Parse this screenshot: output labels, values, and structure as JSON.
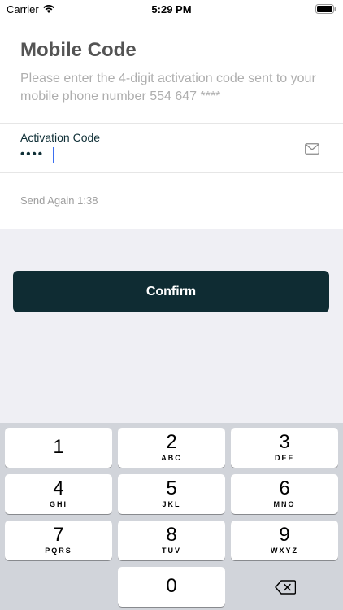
{
  "status_bar": {
    "carrier": "Carrier",
    "time": "5:29 PM"
  },
  "header": {
    "title": "Mobile Code",
    "subtitle": "Please enter the 4-digit activation code sent to your mobile phone number 554 647 ****"
  },
  "activation_field": {
    "label": "Activation Code",
    "value": "••••",
    "icon": "mail-icon"
  },
  "resend": {
    "label": "Send Again 1:38"
  },
  "confirm": {
    "label": "Confirm"
  },
  "colors": {
    "primary": "#0f2c33",
    "background": "#efeff4",
    "caret": "#3b6ff0"
  },
  "keypad": {
    "keys": [
      {
        "digit": "1",
        "letters": ""
      },
      {
        "digit": "2",
        "letters": "ABC"
      },
      {
        "digit": "3",
        "letters": "DEF"
      },
      {
        "digit": "4",
        "letters": "GHI"
      },
      {
        "digit": "5",
        "letters": "JKL"
      },
      {
        "digit": "6",
        "letters": "MNO"
      },
      {
        "digit": "7",
        "letters": "PQRS"
      },
      {
        "digit": "8",
        "letters": "TUV"
      },
      {
        "digit": "9",
        "letters": "WXYZ"
      },
      {
        "digit": "0",
        "letters": ""
      }
    ]
  }
}
